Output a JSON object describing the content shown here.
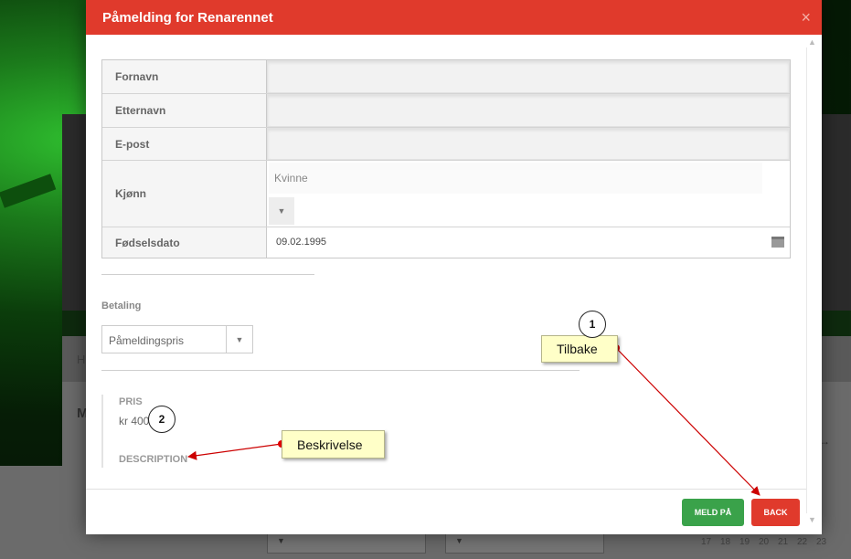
{
  "modal": {
    "title": "Påmelding for Renarennet",
    "close_label": "×",
    "fields": {
      "fornavn": "Fornavn",
      "etternavn": "Etternavn",
      "epost": "E-post",
      "kjonn": "Kjønn",
      "kjonn_value": "Kvinne",
      "fodselsdato": "Fødselsdato",
      "fodselsdato_value": "09.02.1995"
    },
    "betaling": {
      "label": "Betaling",
      "select_value": "Påmeldingspris"
    },
    "pris": {
      "label": "PRIS",
      "value": "kr 400"
    },
    "description_label": "DESCRIPTION",
    "buttons": {
      "meld_pa": "MELD PÅ",
      "back": "BACK"
    }
  },
  "callouts": {
    "c1": {
      "number": "1",
      "text": "Tilbake"
    },
    "c2": {
      "number": "2",
      "text": "Beskrivelse"
    }
  },
  "background": {
    "crumb": "H",
    "heading": "M",
    "calendar": [
      "17",
      "18",
      "19",
      "20",
      "21",
      "22",
      "23"
    ]
  },
  "colors": {
    "header": "#e03a2c",
    "meld_button": "#3aa24a",
    "back_button": "#e03a2c",
    "callout": "#ffffc8"
  }
}
